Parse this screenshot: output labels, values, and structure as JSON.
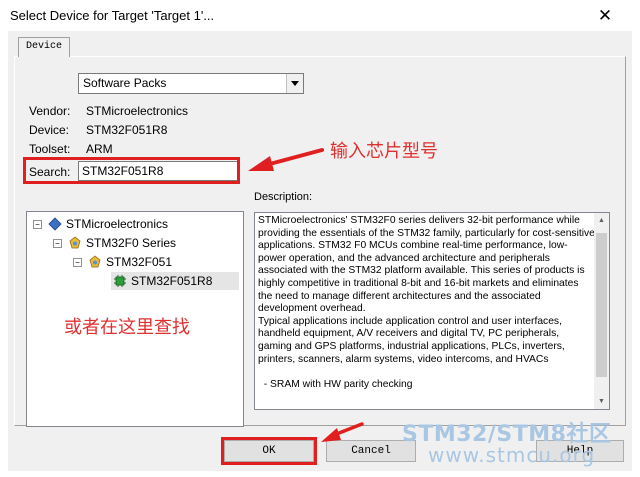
{
  "window": {
    "title": "Select Device for Target 'Target 1'...",
    "close_glyph": "✕"
  },
  "tab": {
    "label": "Device"
  },
  "packs": {
    "selected": "Software Packs"
  },
  "info": {
    "vendor_label": "Vendor:",
    "vendor_value": "STMicroelectronics",
    "device_label": "Device:",
    "device_value": "STM32F051R8",
    "toolset_label": "Toolset:",
    "toolset_value": "ARM"
  },
  "search": {
    "label": "Search:",
    "value": "STM32F051R8"
  },
  "annotations": {
    "input_chip": "输入芯片型号",
    "find_here": "或者在这里查找"
  },
  "tree": {
    "items": [
      {
        "label": "STMicroelectronics",
        "expander": "−"
      },
      {
        "label": "STM32F0 Series",
        "expander": "−"
      },
      {
        "label": "STM32F051",
        "expander": "−"
      },
      {
        "label": "STM32F051R8"
      }
    ]
  },
  "description": {
    "label": "Description:",
    "text": "STMicroelectronics' STM32F0 series delivers 32-bit performance while providing the essentials of the STM32 family, particularly for cost-sensitive applications. STM32 F0 MCUs combine real-time performance, low-power operation, and the advanced architecture and peripherals associated with the STM32 platform available. This series of products is highly competitive in traditional 8-bit and 16-bit markets and eliminates the need to manage different architectures and the associated development overhead.\nTypical applications include application control and user interfaces, handheld equipment, A/V receivers and digital TV, PC peripherals, gaming and GPS platforms, industrial applications, PLCs, inverters, printers, scanners, alarm systems, video intercoms, and HVACs\n\n  - SRAM with HW parity checking"
  },
  "buttons": {
    "ok": "OK",
    "cancel": "Cancel",
    "help": "Help"
  },
  "watermark": {
    "line1": "STM32/STM8社区",
    "line2": "www.stmcu.org"
  },
  "colors": {
    "annotation_red": "#e02020",
    "watermark": "#a9c7e3"
  }
}
